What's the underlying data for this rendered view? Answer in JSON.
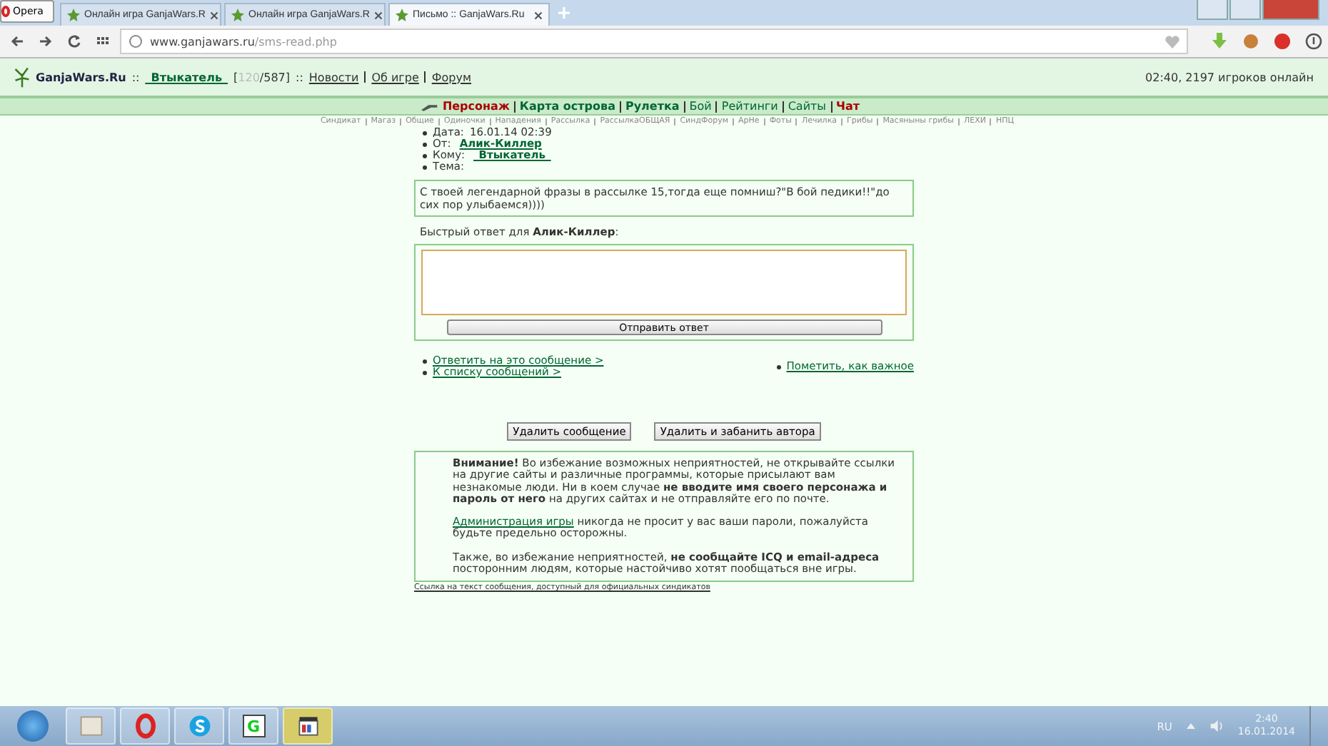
{
  "browser": {
    "menu_label": "Opera",
    "tabs": [
      {
        "title": "Онлайн игра GanjaWars.R",
        "selected": false
      },
      {
        "title": "Онлайн игра GanjaWars.R",
        "selected": false
      },
      {
        "title": "Письмо :: GanjaWars.Ru",
        "selected": true
      }
    ],
    "url": {
      "host": "www.ganjawars.ru",
      "path": "/sms-read.php"
    }
  },
  "header": {
    "site": "GanjaWars.Ru",
    "sep": "::",
    "user": "_Втыкатель_",
    "hp_open": "[",
    "hp_current": "120",
    "hp_max": "/587]",
    "links": [
      "Новости",
      "Об игре",
      "Форум"
    ],
    "online": "02:40, 2197 игроков онлайн"
  },
  "nav": [
    {
      "label": "Персонаж",
      "kind": "red"
    },
    {
      "label": "Карта острова",
      "kind": "bold"
    },
    {
      "label": "Рулетка",
      "kind": "bold"
    },
    {
      "label": "Бой",
      "kind": "plain"
    },
    {
      "label": "Рейтинги",
      "kind": "plain"
    },
    {
      "label": "Сайты",
      "kind": "plain"
    },
    {
      "label": "Чат",
      "kind": "red"
    }
  ],
  "subnav": [
    "Синдикат",
    "Магаз",
    "Общие",
    "Одиночки",
    "Нападения",
    "Рассылка",
    "РассылкаОБЩАЯ",
    "СиндФорум",
    "АрНе",
    "Фоты",
    "Лечилка",
    "Грибы",
    "Масяныны грибы",
    "ЛЕХИ",
    "НПЦ"
  ],
  "message": {
    "fields": [
      {
        "label": "Дата:",
        "value": "16.01.14 02:39",
        "kind": "text"
      },
      {
        "label": "От:",
        "value": "Алик-Киллер",
        "kind": "link"
      },
      {
        "label": "Кому:",
        "value": "_Втыкатель_",
        "kind": "link"
      },
      {
        "label": "Тема:"
      }
    ],
    "body": "С твоей легендарной фразы в рассылке 15,тогда еще помниш?\"В бой педики!!\"до сих пор улыбаемся))))",
    "reply_label": "Быстрый ответ для **Алик-Киллер**:",
    "send_button": "Отправить ответ",
    "links_left": [
      "Ответить на это сообщение >",
      "К списку сообщений >"
    ],
    "link_right": "Пометить, как важное",
    "buttons": [
      "Удалить сообщение",
      "Удалить и забанить автора"
    ]
  },
  "warning": [
    {
      "text": "**Внимание!** Во избежание возможных неприятностей, не открывайте ссылки на другие сайты и различные программы, которые присылают вам незнакомые люди. Ни в коем случае **не вводите имя своего персонажа и пароль от него** на других сайтах и не отправляйте его по почте."
    },
    {
      "link": "Администрация игры",
      "text": " никогда не просит у вас ваши пароли, пожалуйста будьте предельно осторожны."
    },
    {
      "text": "Также, во избежание неприятностей, **не сообщайте ICQ и email-адреса** посторонним людям, которые настойчиво хотят пообщаться вне игры."
    }
  ],
  "footer_link": "Ссылка на текст сообщения, доступный для официальных синдикатов",
  "taskbar": {
    "g_label": "G",
    "lang": "RU",
    "time": "2:40",
    "date": "16.01.2014"
  }
}
